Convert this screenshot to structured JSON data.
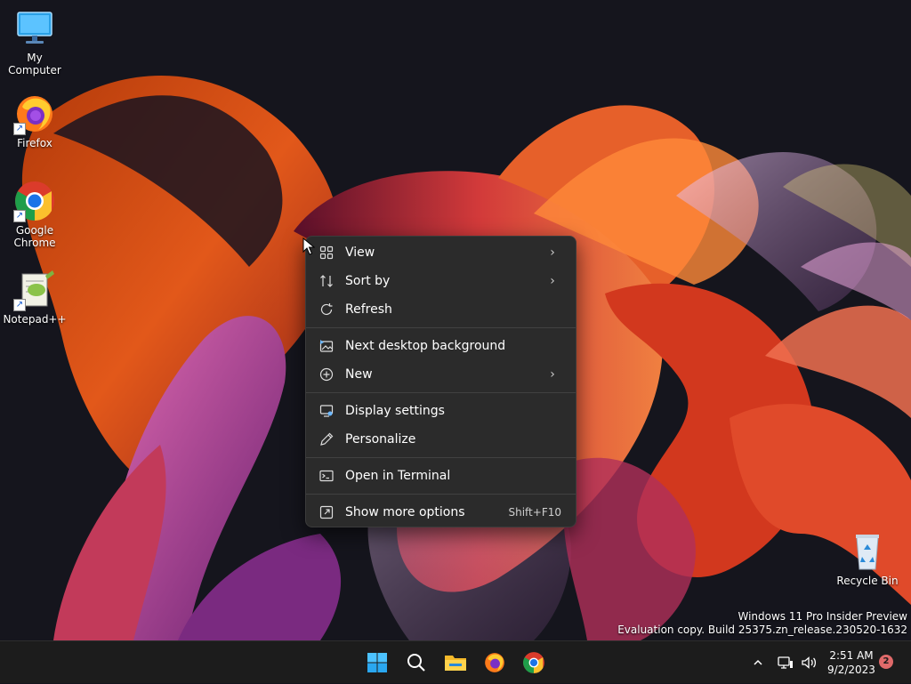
{
  "desktop": {
    "icons": [
      {
        "label": "My Computer"
      },
      {
        "label": "Firefox"
      },
      {
        "label": "Google\nChrome"
      },
      {
        "label": "Notepad++"
      },
      {
        "label": "Recycle Bin"
      }
    ]
  },
  "context_menu": {
    "items": [
      {
        "label": "View",
        "icon": "grid-view-icon",
        "submenu": true
      },
      {
        "label": "Sort by",
        "icon": "sort-icon",
        "submenu": true
      },
      {
        "label": "Refresh",
        "icon": "refresh-icon"
      },
      {
        "label": "Next desktop background",
        "icon": "background-icon"
      },
      {
        "label": "New",
        "icon": "plus-circle-icon",
        "submenu": true
      },
      {
        "label": "Display settings",
        "icon": "display-icon"
      },
      {
        "label": "Personalize",
        "icon": "pen-icon"
      },
      {
        "label": "Open in Terminal",
        "icon": "terminal-icon"
      },
      {
        "label": "Show more options",
        "icon": "more-options-icon",
        "shortcut": "Shift+F10"
      }
    ]
  },
  "watermark": {
    "line1": "Windows 11 Pro Insider Preview",
    "line2": "Evaluation copy. Build 25375.zn_release.230520-1632"
  },
  "taskbar": {
    "pinned": [
      "start-icon",
      "search-icon",
      "file-explorer-icon",
      "firefox-icon",
      "chrome-icon"
    ],
    "clock": {
      "time": "2:51 AM",
      "date": "9/2/2023"
    },
    "notification_count": "2"
  }
}
